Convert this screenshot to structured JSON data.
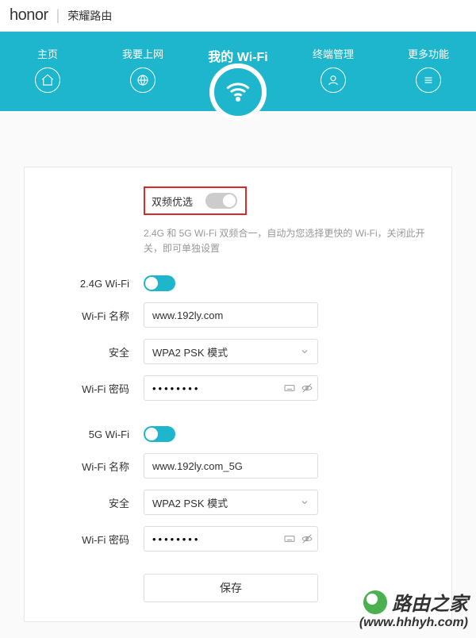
{
  "header": {
    "logo": "honor",
    "product_name": "荣耀路由"
  },
  "nav": {
    "items": [
      {
        "label": "主页"
      },
      {
        "label": "我要上网"
      },
      {
        "label": "我的 Wi-Fi"
      },
      {
        "label": "终端管理"
      },
      {
        "label": "更多功能"
      }
    ]
  },
  "wifi": {
    "dual_band_label": "双频优选",
    "dual_band_on": false,
    "dual_band_desc": "2.4G 和 5G Wi-Fi 双频合一，自动为您选择更快的 Wi-Fi，关闭此开关，即可单独设置",
    "g24": {
      "enable_label": "2.4G Wi-Fi",
      "enable_on": true,
      "name_label": "Wi-Fi 名称",
      "name_value": "www.192ly.com",
      "security_label": "安全",
      "security_value": "WPA2 PSK 模式",
      "password_label": "Wi-Fi 密码",
      "password_value": "••••••••"
    },
    "g5": {
      "enable_label": "5G Wi-Fi",
      "enable_on": true,
      "name_label": "Wi-Fi 名称",
      "name_value": "www.192ly.com_5G",
      "security_label": "安全",
      "security_value": "WPA2 PSK 模式",
      "password_label": "Wi-Fi 密码",
      "password_value": "••••••••"
    },
    "save_label": "保存"
  },
  "watermark": {
    "title": "路由之家",
    "url": "(www.hhhyh.com)"
  }
}
